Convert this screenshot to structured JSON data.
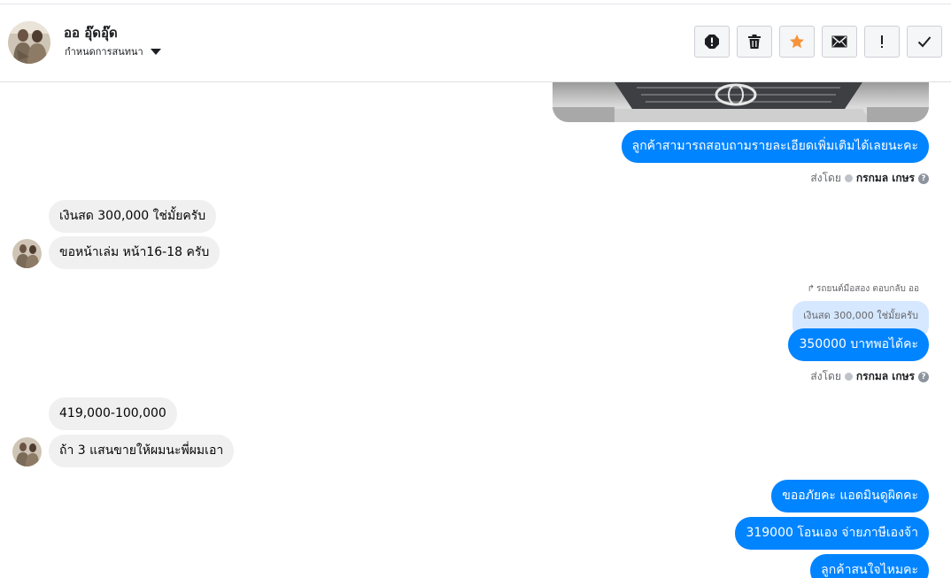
{
  "header": {
    "name": "ออ อุ๊ดอุ๊ด",
    "assign_label": "กำหนดการสนทนา"
  },
  "toolbar": {
    "buttons": [
      "alert-icon",
      "trash-icon",
      "star-icon",
      "envelope-icon",
      "exclamation-icon",
      "check-icon"
    ],
    "star_color": "#f7923a"
  },
  "messages": {
    "out_1": "ลูกค้าสามารถสอบถามรายละเอียดเพิ่มเติมได้เลยนะคะ",
    "sent_by_label": "ส่งโดย",
    "sent_by_name": "กรกมล เกษร",
    "in_1": "เงินสด 300,000 ใช่มั้ยครับ",
    "in_2": "ขอหน้าเล่ม หน้า16-18 ครับ",
    "reply_note": "รถยนต์มือสอง ตอบกลับ ออ",
    "quoted_text": "เงินสด 300,000 ใช่มั้ยครับ",
    "out_2": "350000 บาทพอได้คะ",
    "in_3": "419,000-100,000",
    "in_4": "ถ้า 3 แสนขายให้ผมนะพี่ผมเอา",
    "out_3": "ขออภัยคะ แอดมินดูผิดคะ",
    "out_4": "319000 โอนเอง จ่ายภาษีเองจ้า",
    "out_5": "ลูกค้าสนใจไหมคะ"
  },
  "colors": {
    "outgoing": "#0084ff",
    "incoming": "#f0f0f0",
    "quoted": "#d6e8ff"
  }
}
